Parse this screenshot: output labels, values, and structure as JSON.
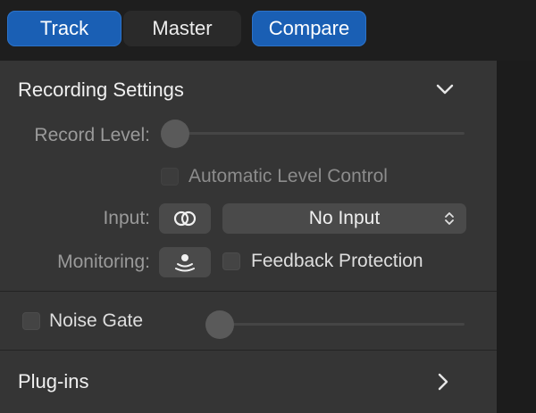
{
  "tabs": [
    {
      "label": "Track",
      "active": true
    },
    {
      "label": "Master",
      "active": false
    },
    {
      "label": "Compare",
      "active": true
    }
  ],
  "recording_settings": {
    "title": "Recording Settings",
    "record_level_label": "Record Level:",
    "record_level_value": 0,
    "automatic_level_control_label": "Automatic Level Control",
    "automatic_level_control_checked": false,
    "input_label": "Input:",
    "input_value": "No Input",
    "monitoring_label": "Monitoring:",
    "feedback_protection_label": "Feedback Protection",
    "feedback_protection_checked": false
  },
  "noise_gate": {
    "label": "Noise Gate",
    "checked": false,
    "level": 0
  },
  "plugins": {
    "title": "Plug-ins"
  },
  "colors": {
    "accent": "#1a5fb4",
    "panel": "#353535",
    "background": "#1e1e1e"
  }
}
